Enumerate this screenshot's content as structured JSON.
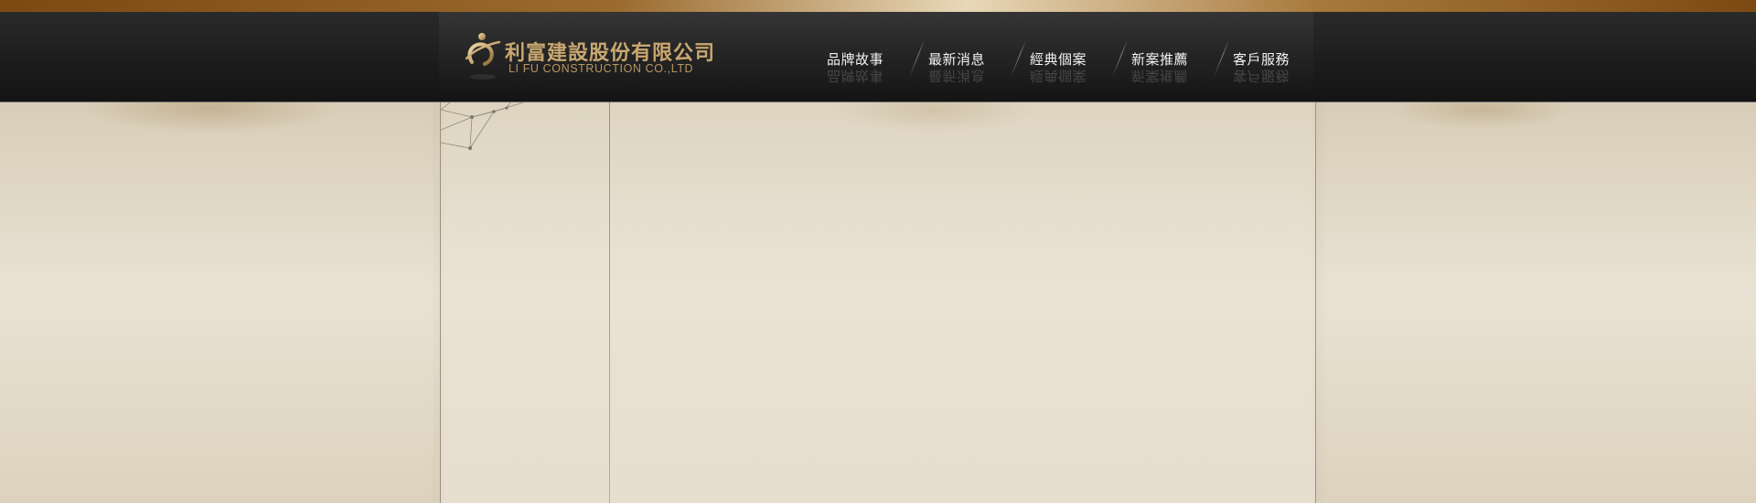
{
  "brand": {
    "name_zh": "利富建設股份有限公司",
    "name_en": "LI FU CONSTRUCTION CO.,LTD",
    "logo_icon": "lifu-logo-icon",
    "accent_color": "#c9a770"
  },
  "nav": {
    "items": [
      {
        "label": "品牌故事"
      },
      {
        "label": "最新消息"
      },
      {
        "label": "經典個案"
      },
      {
        "label": "新案推薦"
      },
      {
        "label": "客戶服務"
      }
    ],
    "text_color": "#f2f2f2"
  },
  "colors": {
    "header_bg": "#1e1e1e",
    "top_strip": "#9a6a2e",
    "page_bg": "#e3dac8"
  }
}
